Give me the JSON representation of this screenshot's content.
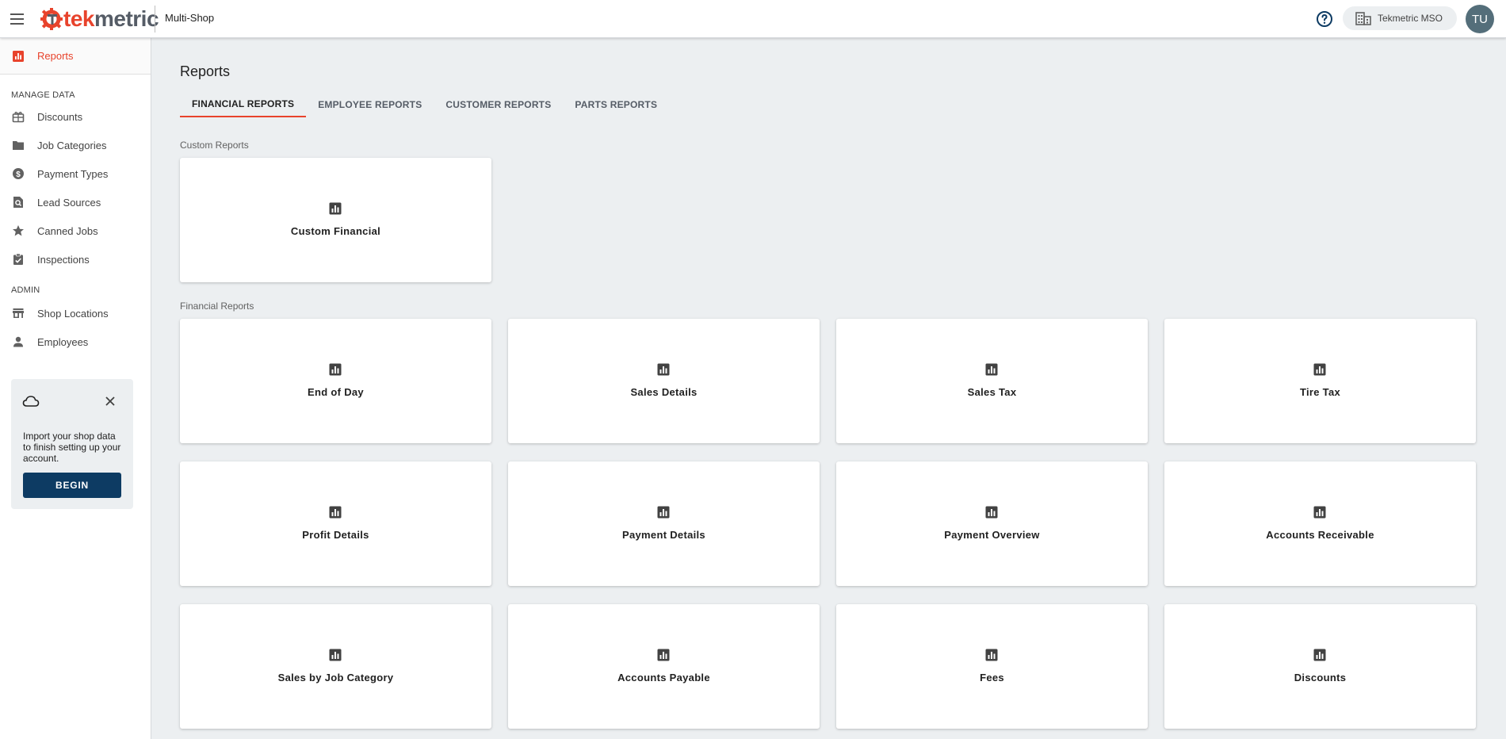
{
  "header": {
    "logo_text_tek": "tek",
    "logo_text_metric": "metric",
    "shop_name": "Multi-Shop",
    "shop_selector": "Tekmetric MSO",
    "avatar_initials": "TU"
  },
  "sidebar": {
    "active_item": "Reports",
    "manage_data_title": "MANAGE DATA",
    "manage_items": [
      {
        "label": "Discounts",
        "icon": "discount-icon"
      },
      {
        "label": "Job Categories",
        "icon": "folder-icon"
      },
      {
        "label": "Payment Types",
        "icon": "dollar-circle-icon"
      },
      {
        "label": "Lead Sources",
        "icon": "search-document-icon"
      },
      {
        "label": "Canned Jobs",
        "icon": "star-icon"
      },
      {
        "label": "Inspections",
        "icon": "clipboard-check-icon"
      }
    ],
    "admin_title": "ADMIN",
    "admin_items": [
      {
        "label": "Shop Locations",
        "icon": "store-icon"
      },
      {
        "label": "Employees",
        "icon": "person-icon"
      }
    ],
    "import_card": {
      "message": "Import your shop data to finish setting up your account.",
      "button": "BEGIN"
    }
  },
  "main": {
    "title": "Reports",
    "tabs": [
      "FINANCIAL REPORTS",
      "EMPLOYEE REPORTS",
      "CUSTOMER REPORTS",
      "PARTS REPORTS"
    ],
    "active_tab": "FINANCIAL REPORTS",
    "custom_section_label": "Custom Reports",
    "custom_reports": [
      "Custom Financial"
    ],
    "financial_section_label": "Financial Reports",
    "financial_reports": [
      "End of Day",
      "Sales Details",
      "Sales Tax",
      "Tire Tax",
      "Profit Details",
      "Payment Details",
      "Payment Overview",
      "Accounts Receivable",
      "Sales by Job Category",
      "Accounts Payable",
      "Fees",
      "Discounts"
    ]
  },
  "colors": {
    "accent": "#e8432c",
    "primary_button": "#0d3b63",
    "background": "#eceff1",
    "avatar": "#546e7a"
  }
}
